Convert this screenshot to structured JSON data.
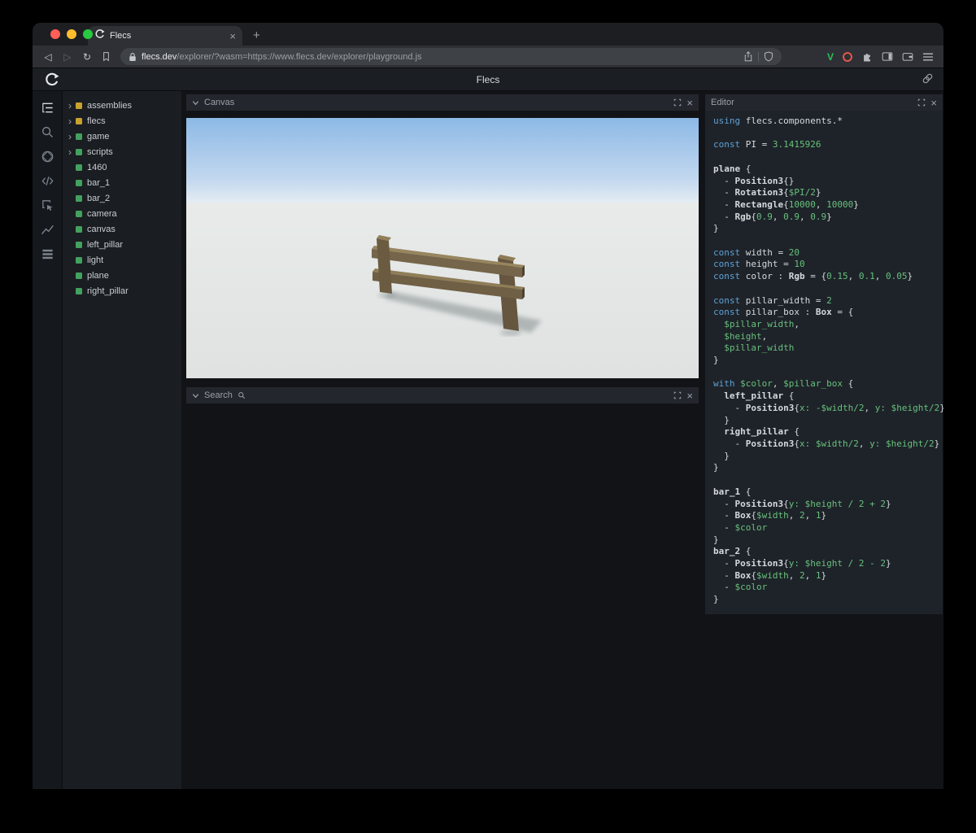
{
  "theme": {
    "module_yellow": "#c9a22c",
    "entity_green": "#43a15e",
    "keyword_blue": "#5fa0d4",
    "value_green": "#68c07c",
    "code_plain": "#d5d9dd",
    "v_icon_green": "#2bc059",
    "brave_icon_red": "#e2574c"
  },
  "icons": {
    "close": "×",
    "new_tab": "+",
    "back": "◁",
    "forward": "▷",
    "reload": "↻",
    "chevron_right": "›"
  },
  "browser": {
    "tab": {
      "title": "Flecs"
    },
    "url": {
      "domain": "flecs.dev",
      "path": "/explorer/?wasm=https://www.flecs.dev/explorer/playground.js"
    }
  },
  "page": {
    "title": "Flecs"
  },
  "tree": {
    "items": [
      {
        "label": "assemblies",
        "kind": "module",
        "expandable": true
      },
      {
        "label": "flecs",
        "kind": "module",
        "expandable": true
      },
      {
        "label": "game",
        "kind": "entity",
        "expandable": true
      },
      {
        "label": "scripts",
        "kind": "entity",
        "expandable": true
      },
      {
        "label": "1460",
        "kind": "entity",
        "expandable": false
      },
      {
        "label": "bar_1",
        "kind": "entity",
        "expandable": false
      },
      {
        "label": "bar_2",
        "kind": "entity",
        "expandable": false
      },
      {
        "label": "camera",
        "kind": "entity",
        "expandable": false
      },
      {
        "label": "canvas",
        "kind": "entity",
        "expandable": false
      },
      {
        "label": "left_pillar",
        "kind": "entity",
        "expandable": false
      },
      {
        "label": "light",
        "kind": "entity",
        "expandable": false
      },
      {
        "label": "plane",
        "kind": "entity",
        "expandable": false
      },
      {
        "label": "right_pillar",
        "kind": "entity",
        "expandable": false
      }
    ]
  },
  "panels": {
    "canvas": {
      "title": "Canvas"
    },
    "search": {
      "title": "Search"
    },
    "editor": {
      "title": "Editor"
    }
  },
  "scene": {
    "sky_top": "#8db9e6",
    "sky_horizon": "#e7edf3",
    "ground": "#e6e9e8",
    "fence_front": "#6f5f45",
    "fence_top": "#93815c",
    "shadow": "#8f9697"
  },
  "editor": {
    "lines": [
      [
        [
          "k",
          "using "
        ],
        [
          "p",
          "flecs.components.*"
        ]
      ],
      [],
      [
        [
          "k",
          "const "
        ],
        [
          "p",
          "PI = "
        ],
        [
          "g",
          "3.1415926"
        ]
      ],
      [],
      [
        [
          "b",
          "plane "
        ],
        [
          "p",
          "{"
        ]
      ],
      [
        [
          "p",
          "  - "
        ],
        [
          "b",
          "Position3"
        ],
        [
          "p",
          "{}"
        ]
      ],
      [
        [
          "p",
          "  - "
        ],
        [
          "b",
          "Rotation3"
        ],
        [
          "p",
          "{"
        ],
        [
          "g",
          "$PI/2"
        ],
        [
          "p",
          "}"
        ]
      ],
      [
        [
          "p",
          "  - "
        ],
        [
          "b",
          "Rectangle"
        ],
        [
          "p",
          "{"
        ],
        [
          "g",
          "10000"
        ],
        [
          "p",
          ", "
        ],
        [
          "g",
          "10000"
        ],
        [
          "p",
          "}"
        ]
      ],
      [
        [
          "p",
          "  - "
        ],
        [
          "b",
          "Rgb"
        ],
        [
          "p",
          "{"
        ],
        [
          "g",
          "0.9"
        ],
        [
          "p",
          ", "
        ],
        [
          "g",
          "0.9"
        ],
        [
          "p",
          ", "
        ],
        [
          "g",
          "0.9"
        ],
        [
          "p",
          "}"
        ]
      ],
      [
        [
          "p",
          "}"
        ]
      ],
      [],
      [
        [
          "k",
          "const "
        ],
        [
          "p",
          "width = "
        ],
        [
          "g",
          "20"
        ]
      ],
      [
        [
          "k",
          "const "
        ],
        [
          "p",
          "height = "
        ],
        [
          "g",
          "10"
        ]
      ],
      [
        [
          "k",
          "const "
        ],
        [
          "p",
          "color : "
        ],
        [
          "b",
          "Rgb"
        ],
        [
          "p",
          " = {"
        ],
        [
          "g",
          "0.15"
        ],
        [
          "p",
          ", "
        ],
        [
          "g",
          "0.1"
        ],
        [
          "p",
          ", "
        ],
        [
          "g",
          "0.05"
        ],
        [
          "p",
          "}"
        ]
      ],
      [],
      [
        [
          "k",
          "const "
        ],
        [
          "p",
          "pillar_width = "
        ],
        [
          "g",
          "2"
        ]
      ],
      [
        [
          "k",
          "const "
        ],
        [
          "p",
          "pillar_box : "
        ],
        [
          "b",
          "Box"
        ],
        [
          "p",
          " = {"
        ]
      ],
      [
        [
          "p",
          "  "
        ],
        [
          "g",
          "$pillar_width"
        ],
        [
          "p",
          ","
        ]
      ],
      [
        [
          "p",
          "  "
        ],
        [
          "g",
          "$height"
        ],
        [
          "p",
          ","
        ]
      ],
      [
        [
          "p",
          "  "
        ],
        [
          "g",
          "$pillar_width"
        ]
      ],
      [
        [
          "p",
          "}"
        ]
      ],
      [],
      [
        [
          "k",
          "with "
        ],
        [
          "g",
          "$color"
        ],
        [
          "p",
          ", "
        ],
        [
          "g",
          "$pillar_box"
        ],
        [
          "p",
          " {"
        ]
      ],
      [
        [
          "p",
          "  "
        ],
        [
          "b",
          "left_pillar "
        ],
        [
          "p",
          "{"
        ]
      ],
      [
        [
          "p",
          "    - "
        ],
        [
          "b",
          "Position3"
        ],
        [
          "p",
          "{"
        ],
        [
          "g",
          "x: -$width/2"
        ],
        [
          "p",
          ", "
        ],
        [
          "g",
          "y: $height/2"
        ],
        [
          "p",
          "}"
        ]
      ],
      [
        [
          "p",
          "  }"
        ]
      ],
      [
        [
          "p",
          "  "
        ],
        [
          "b",
          "right_pillar "
        ],
        [
          "p",
          "{"
        ]
      ],
      [
        [
          "p",
          "    - "
        ],
        [
          "b",
          "Position3"
        ],
        [
          "p",
          "{"
        ],
        [
          "g",
          "x: $width/2"
        ],
        [
          "p",
          ", "
        ],
        [
          "g",
          "y: $height/2"
        ],
        [
          "p",
          "}"
        ]
      ],
      [
        [
          "p",
          "  }"
        ]
      ],
      [
        [
          "p",
          "}"
        ]
      ],
      [],
      [
        [
          "b",
          "bar_1 "
        ],
        [
          "p",
          "{"
        ]
      ],
      [
        [
          "p",
          "  - "
        ],
        [
          "b",
          "Position3"
        ],
        [
          "p",
          "{"
        ],
        [
          "g",
          "y: $height / 2 + 2"
        ],
        [
          "p",
          "}"
        ]
      ],
      [
        [
          "p",
          "  - "
        ],
        [
          "b",
          "Box"
        ],
        [
          "p",
          "{"
        ],
        [
          "g",
          "$width"
        ],
        [
          "p",
          ", "
        ],
        [
          "g",
          "2"
        ],
        [
          "p",
          ", "
        ],
        [
          "g",
          "1"
        ],
        [
          "p",
          "}"
        ]
      ],
      [
        [
          "p",
          "  - "
        ],
        [
          "g",
          "$color"
        ]
      ],
      [
        [
          "p",
          "}"
        ]
      ],
      [
        [
          "b",
          "bar_2 "
        ],
        [
          "p",
          "{"
        ]
      ],
      [
        [
          "p",
          "  - "
        ],
        [
          "b",
          "Position3"
        ],
        [
          "p",
          "{"
        ],
        [
          "g",
          "y: $height / 2 - 2"
        ],
        [
          "p",
          "}"
        ]
      ],
      [
        [
          "p",
          "  - "
        ],
        [
          "b",
          "Box"
        ],
        [
          "p",
          "{"
        ],
        [
          "g",
          "$width"
        ],
        [
          "p",
          ", "
        ],
        [
          "g",
          "2"
        ],
        [
          "p",
          ", "
        ],
        [
          "g",
          "1"
        ],
        [
          "p",
          "}"
        ]
      ],
      [
        [
          "p",
          "  - "
        ],
        [
          "g",
          "$color"
        ]
      ],
      [
        [
          "p",
          "}"
        ]
      ]
    ]
  }
}
